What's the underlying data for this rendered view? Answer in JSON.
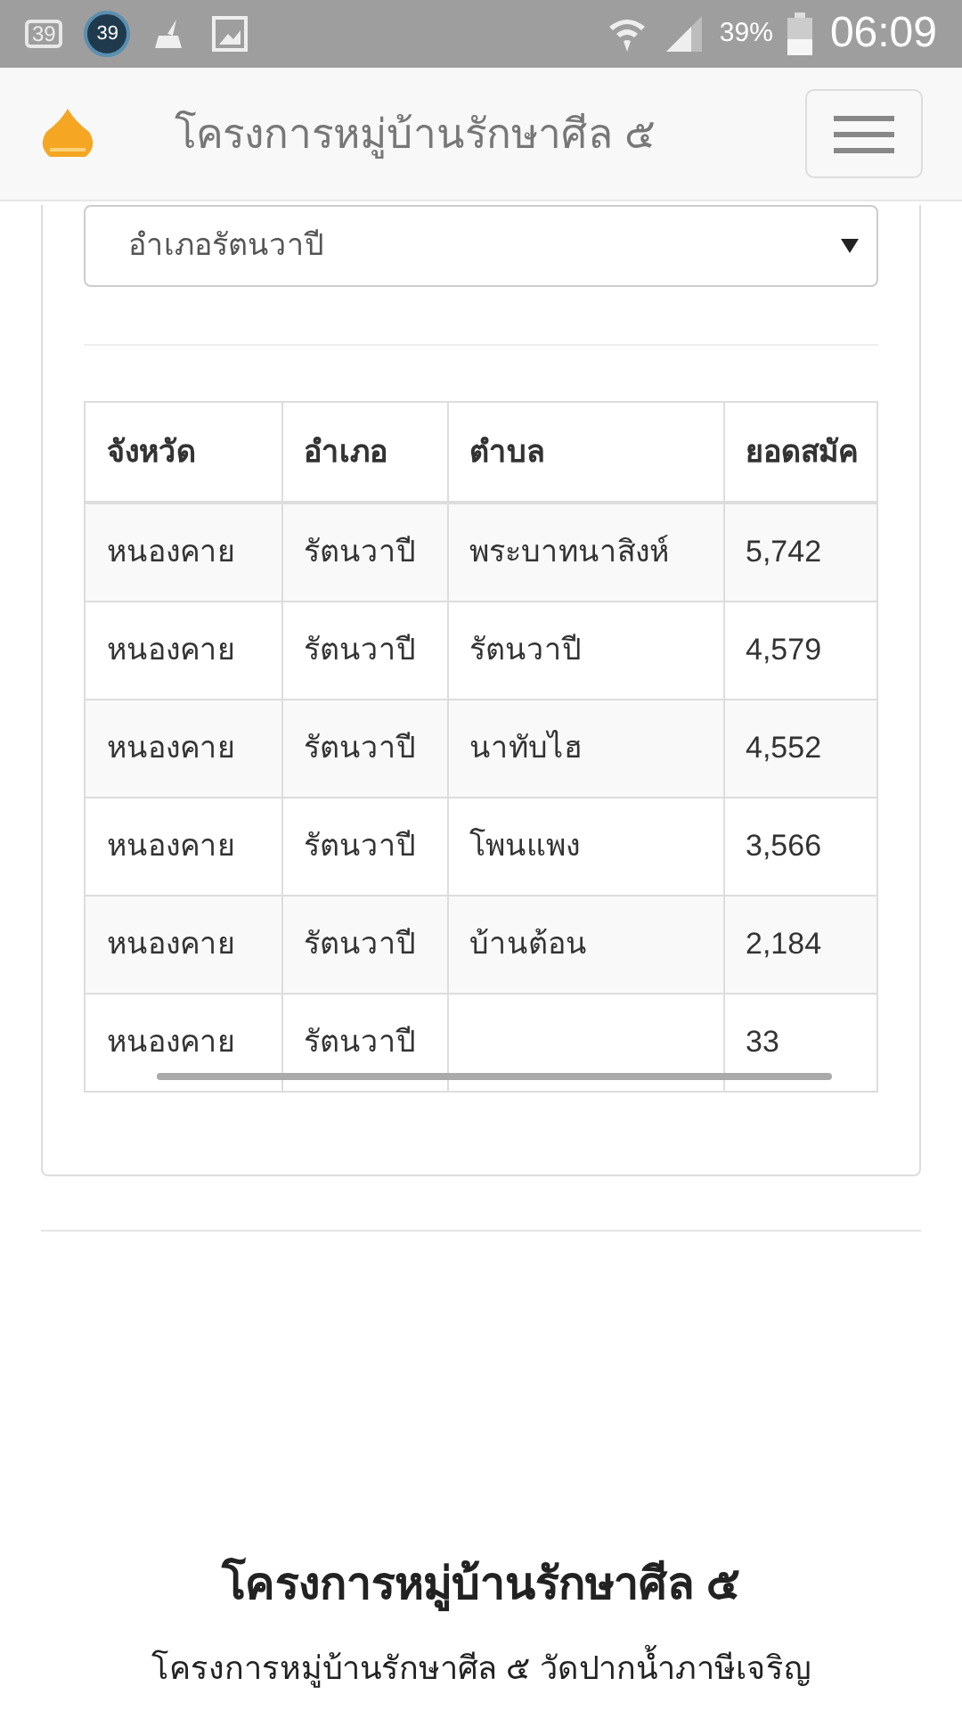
{
  "status_bar": {
    "notification_badge": "39",
    "notification_circle": "39",
    "battery_percent": "39%",
    "time": "06:09"
  },
  "navbar": {
    "title": "โครงการหมู่บ้านรักษาศีล ๕"
  },
  "district_select": {
    "value": "อำเภอรัตนวาปี"
  },
  "table": {
    "columns": [
      "จังหวัด",
      "อำเภอ",
      "ตำบล",
      "ยอดสมัค"
    ],
    "rows": [
      {
        "province": "หนองคาย",
        "district": "รัตนวาปี",
        "subdistrict": "พระบาทนาสิงห์",
        "count": "5,742"
      },
      {
        "province": "หนองคาย",
        "district": "รัตนวาปี",
        "subdistrict": "รัตนวาปี",
        "count": "4,579"
      },
      {
        "province": "หนองคาย",
        "district": "รัตนวาปี",
        "subdistrict": "นาทับไฮ",
        "count": "4,552"
      },
      {
        "province": "หนองคาย",
        "district": "รัตนวาปี",
        "subdistrict": "โพนแพง",
        "count": "3,566"
      },
      {
        "province": "หนองคาย",
        "district": "รัตนวาปี",
        "subdistrict": "บ้านต้อน",
        "count": "2,184"
      },
      {
        "province": "หนองคาย",
        "district": "รัตนวาปี",
        "count": "33"
      }
    ]
  },
  "footer": {
    "title": "โครงการหมู่บ้านรักษาศีล ๕",
    "subtitle": "โครงการหมู่บ้านรักษาศีล ๕ วัดปากน้ำภาษีเจริญ"
  }
}
